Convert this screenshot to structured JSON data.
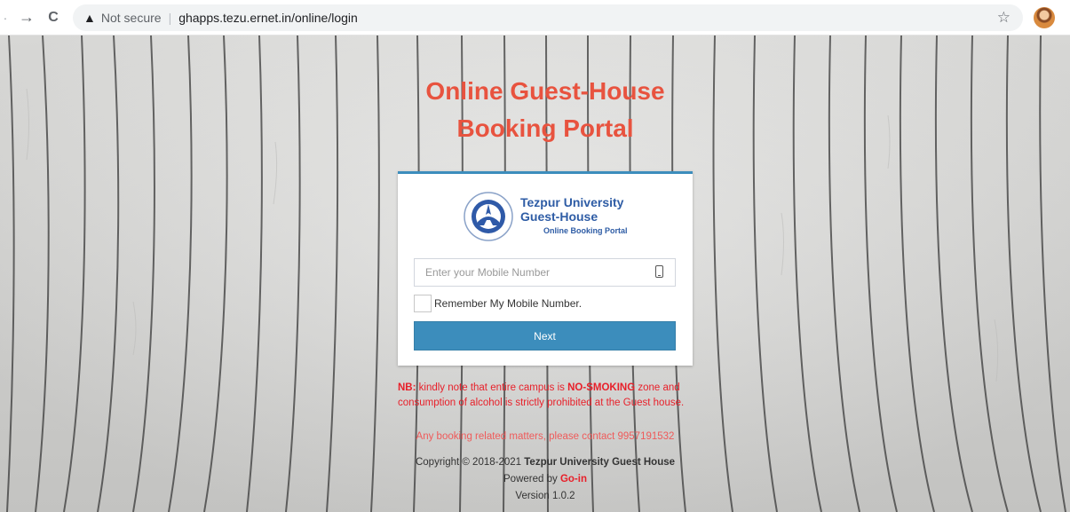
{
  "browser": {
    "nav_back": "←",
    "nav_forward": "→",
    "reload": "C",
    "security_icon": "warning-triangle-icon",
    "security_text": "Not secure",
    "url": "ghapps.tezu.ernet.in/online/login",
    "bookmark_icon": "☆"
  },
  "page": {
    "title_line1": "Online Guest-House",
    "title_line2": "Booking Portal",
    "title_color": "#e8533f",
    "accent_color": "#3c8dbc"
  },
  "logo": {
    "line1": "Tezpur University",
    "line2": "Guest-House",
    "line3": "Online Booking Portal"
  },
  "form": {
    "mobile_placeholder": "Enter your Mobile Number",
    "mobile_value": "",
    "remember_label": "Remember My Mobile Number.",
    "remember_checked": false,
    "next_label": "Next"
  },
  "notice": {
    "nb_label": "NB:",
    "text_before": " kindly note that entire campus is ",
    "no_smoking": "NO-SMOKING",
    "text_after": " zone and consumption of alcohol is strictly prohibited at the Guest house.",
    "contact": "Any booking related matters, please contact 9957191532"
  },
  "footer": {
    "copyright_prefix": "Copyright © 2018-2021 ",
    "copyright_org": "Tezpur University Guest House",
    "powered_prefix": "Powered by ",
    "powered_by": "Go-in",
    "version": "Version 1.0.2"
  }
}
